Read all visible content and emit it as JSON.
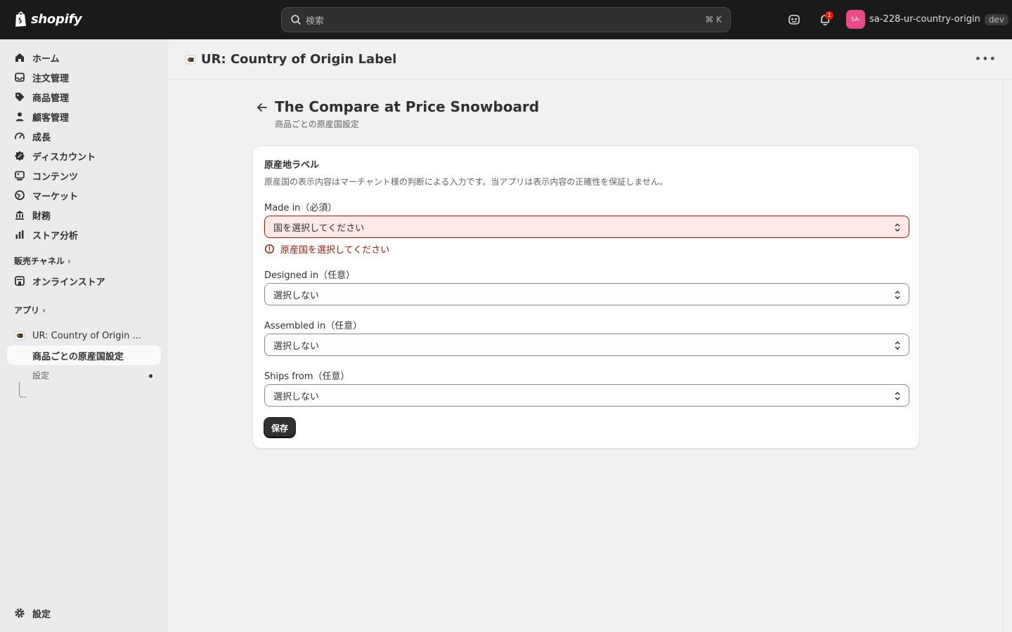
{
  "topbar": {
    "logo_text": "shopify",
    "search_placeholder": "検索",
    "search_shortcut": "⌘  K",
    "notification_count": "1",
    "store_avatar": "SA-",
    "store_name": "sa-228-ur-country-origin",
    "store_badge": "dev"
  },
  "sidebar": {
    "items": [
      {
        "label": "ホーム",
        "icon": "home-icon"
      },
      {
        "label": "注文管理",
        "icon": "inbox-icon"
      },
      {
        "label": "商品管理",
        "icon": "tag-icon"
      },
      {
        "label": "顧客管理",
        "icon": "person-icon"
      },
      {
        "label": "成長",
        "icon": "gauge-icon"
      },
      {
        "label": "ディスカウント",
        "icon": "discount-icon"
      },
      {
        "label": "コンテンツ",
        "icon": "content-icon"
      },
      {
        "label": "マーケット",
        "icon": "globe-icon"
      },
      {
        "label": "財務",
        "icon": "bank-icon"
      },
      {
        "label": "ストア分析",
        "icon": "chart-icon"
      }
    ],
    "sales_channels_label": "販売チャネル",
    "online_store_label": "オンラインストア",
    "apps_label": "アプリ",
    "app_name": "UR: Country of Origin ...",
    "app_sub_active": "商品ごとの原産国設定",
    "app_sub_settings": "設定",
    "settings_label": "設定"
  },
  "app_header": {
    "title": "UR: Country of Origin Label",
    "more": "•••"
  },
  "page": {
    "title": "The Compare at Price Snowboard",
    "subtitle": "商品ごとの原産国設定"
  },
  "card": {
    "title": "原産地ラベル",
    "description": "原産国の表示内容はマーチャント様の判断による入力です。当アプリは表示内容の正確性を保証しません。",
    "made_in_label": "Made in（必須）",
    "made_in_value": "国を選択してください",
    "made_in_error": "原産国を選択してください",
    "designed_in_label": "Designed in（任意）",
    "designed_in_value": "選択しない",
    "assembled_in_label": "Assembled in（任意）",
    "assembled_in_value": "選択しない",
    "ships_from_label": "Ships from（任意）",
    "ships_from_value": "選択しない",
    "save_label": "保存"
  },
  "colors": {
    "topbar_bg": "#1a1a1a",
    "sidebar_bg": "#ebebeb",
    "main_bg": "#f1f1f1",
    "error": "#8e1f0b",
    "error_bg": "#fee9e8",
    "primary_button": "#303030",
    "avatar": "#e84b86",
    "notification_badge": "#e51c00"
  }
}
